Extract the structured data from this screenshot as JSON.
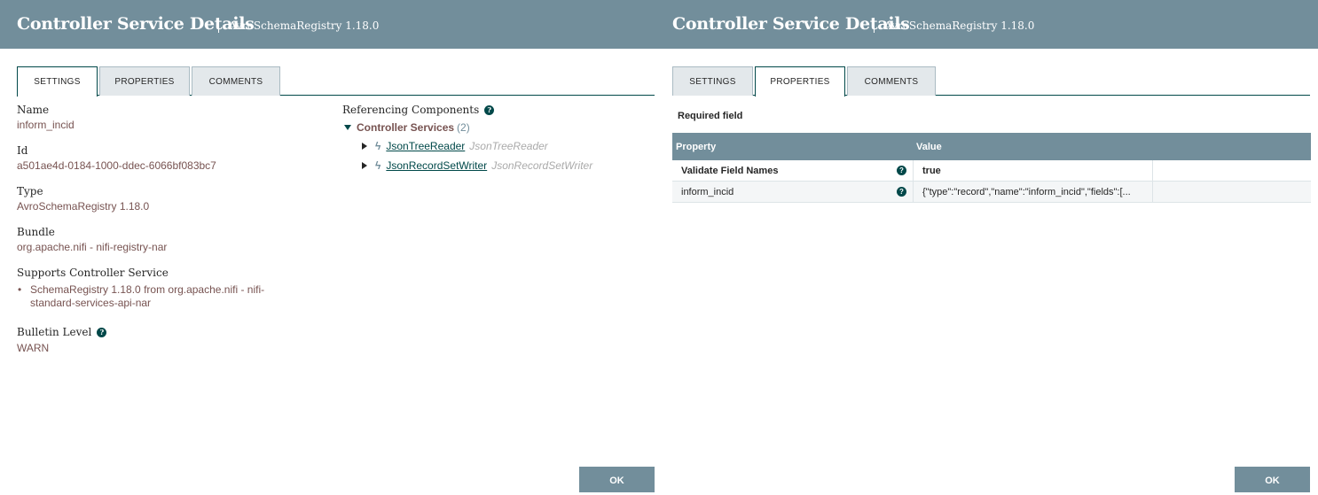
{
  "left": {
    "header": {
      "title": "Controller Service Details",
      "subtitle": "AvroSchemaRegistry 1.18.0"
    },
    "tabs": [
      {
        "label": "SETTINGS",
        "active": true
      },
      {
        "label": "PROPERTIES",
        "active": false
      },
      {
        "label": "COMMENTS",
        "active": false
      }
    ],
    "settings": {
      "name_label": "Name",
      "name_value": "inform_incid",
      "id_label": "Id",
      "id_value": "a501ae4d-0184-1000-ddec-6066bf083bc7",
      "type_label": "Type",
      "type_value": "AvroSchemaRegistry 1.18.0",
      "bundle_label": "Bundle",
      "bundle_value": "org.apache.nifi - nifi-registry-nar",
      "supports_label": "Supports Controller Service",
      "supports_value": "SchemaRegistry 1.18.0 from org.apache.nifi - nifi-standard-services-api-nar",
      "bulletin_label": "Bulletin Level",
      "bulletin_value": "WARN"
    },
    "referencing": {
      "label": "Referencing Components",
      "group_label": "Controller Services",
      "group_count": "(2)",
      "items": [
        {
          "name": "JsonTreeReader",
          "type": "JsonTreeReader"
        },
        {
          "name": "JsonRecordSetWriter",
          "type": "JsonRecordSetWriter"
        }
      ]
    },
    "ok_label": "OK"
  },
  "right": {
    "header": {
      "title": "Controller Service Details",
      "subtitle": "AvroSchemaRegistry 1.18.0"
    },
    "tabs": [
      {
        "label": "SETTINGS",
        "active": false
      },
      {
        "label": "PROPERTIES",
        "active": true
      },
      {
        "label": "COMMENTS",
        "active": false
      }
    ],
    "required_field": "Required field",
    "table": {
      "col_property": "Property",
      "col_value": "Value",
      "rows": [
        {
          "name": "Validate Field Names",
          "value": "true",
          "required": true
        },
        {
          "name": "inform_incid",
          "value": "{\"type\":\"record\",\"name\":\"inform_incid\",\"fields\":[...",
          "required": false
        }
      ]
    },
    "ok_label": "OK"
  },
  "colors": {
    "header_bg": "#728e9b",
    "accent_dark": "#004849",
    "value_text": "#775351"
  },
  "icons": {
    "help": "question-circle-icon",
    "bolt": "bolt-icon"
  }
}
